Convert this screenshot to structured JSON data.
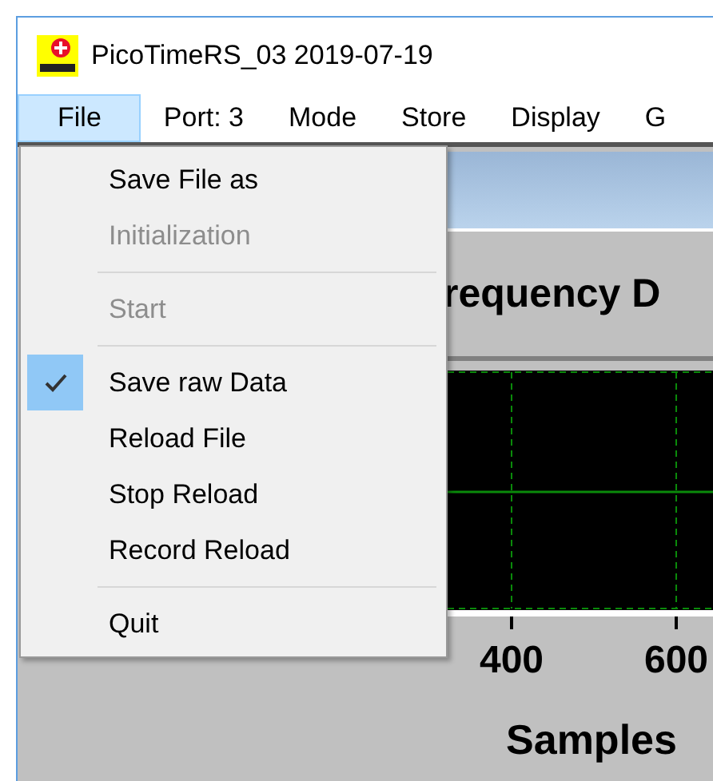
{
  "window": {
    "title": "PicoTimeRS_03 2019-07-19"
  },
  "menu_bar": {
    "items": [
      {
        "label": "File",
        "selected": true
      },
      {
        "label": "Port: 3",
        "selected": false
      },
      {
        "label": "Mode",
        "selected": false
      },
      {
        "label": "Store",
        "selected": false
      },
      {
        "label": "Display",
        "selected": false
      },
      {
        "label": "G",
        "selected": false
      }
    ]
  },
  "file_menu": {
    "items": [
      {
        "kind": "item",
        "label": "Save File as",
        "disabled": false,
        "checked": false
      },
      {
        "kind": "item",
        "label": "Initialization",
        "disabled": true,
        "checked": false
      },
      {
        "kind": "separator"
      },
      {
        "kind": "item",
        "label": "Start",
        "disabled": true,
        "checked": false
      },
      {
        "kind": "separator"
      },
      {
        "kind": "item",
        "label": "Save raw Data",
        "disabled": false,
        "checked": true
      },
      {
        "kind": "item",
        "label": "Reload File",
        "disabled": false,
        "checked": false
      },
      {
        "kind": "item",
        "label": "Stop Reload",
        "disabled": false,
        "checked": false
      },
      {
        "kind": "item",
        "label": "Record Reload",
        "disabled": false,
        "checked": false
      },
      {
        "kind": "separator"
      },
      {
        "kind": "item",
        "label": "Quit",
        "disabled": false,
        "checked": false
      }
    ]
  },
  "plot": {
    "title": "requency D",
    "x_tick_labels": [
      "400",
      "600"
    ],
    "xlabel": "Samples"
  }
}
